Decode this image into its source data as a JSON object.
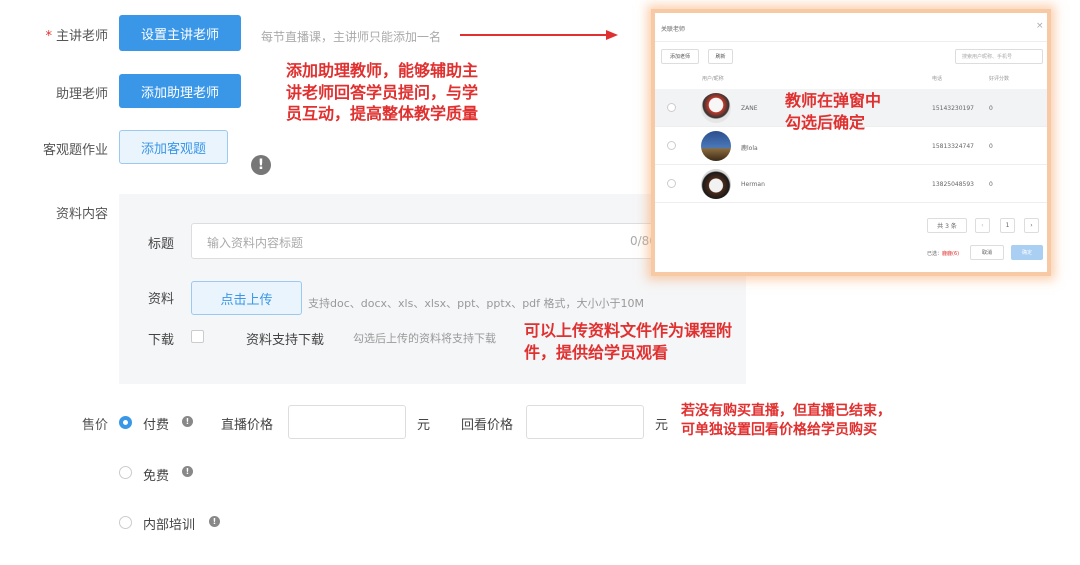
{
  "form": {
    "main_teacher": {
      "label": "主讲老师",
      "required_mark": "*",
      "button": "设置主讲老师",
      "hint": "每节直播课，主讲师只能添加一名"
    },
    "assistant": {
      "label": "助理老师",
      "button": "添加助理老师"
    },
    "objective": {
      "label": "客观题作业",
      "button": "添加客观题"
    },
    "material": {
      "label": "资料内容",
      "title_label": "标题",
      "title_placeholder": "输入资料内容标题",
      "title_counter": "0/80",
      "file_label": "资料",
      "upload_button": "点击上传",
      "upload_hint": "支持doc、docx、xls、xlsx、ppt、pptx、pdf 格式，大小小于10M",
      "download_label": "下载",
      "download_option": "资料支持下载",
      "download_hint": "勾选后上传的资料将支持下载"
    },
    "price": {
      "label": "售价",
      "options": [
        {
          "label": "付费",
          "selected": true
        },
        {
          "label": "免费",
          "selected": false
        },
        {
          "label": "内部培训",
          "selected": false
        }
      ],
      "live_price_label": "直播价格",
      "replay_price_label": "回看价格",
      "unit": "元"
    }
  },
  "annotations": {
    "assistant_line1": "添加助理教师，能够辅助主",
    "assistant_line2": "讲老师回答学员提问，与学",
    "assistant_line3": "员互动，提高整体教学质量",
    "modal_line1": "教师在弹窗中",
    "modal_line2": "勾选后确定",
    "material_line1": "可以上传资料文件作为课程附",
    "material_line2": "件，提供给学员观看",
    "price_line1": "若没有购买直播，但直播已结束，",
    "price_line2": "可单独设置回看价格给学员购买"
  },
  "modal": {
    "title": "关联老师",
    "close": "×",
    "add_button": "添加老师",
    "refresh_button": "刷新",
    "search_placeholder": "搜索用户昵称、手机号",
    "columns": {
      "user": "用户/昵称",
      "phone": "电话",
      "score": "好评分数"
    },
    "rows": [
      {
        "name": "ZANE",
        "phone": "15143230197",
        "score": "0"
      },
      {
        "name": "鹿lola",
        "phone": "15813324747",
        "score": "0"
      },
      {
        "name": "Herman",
        "phone": "13825048593",
        "score": "0"
      }
    ],
    "total": "共 3 条",
    "page": "1",
    "selected_prefix": "已选：",
    "selected_value": "鹿鹿(6)",
    "cancel": "取消",
    "confirm": "确定"
  },
  "colors": {
    "primary": "#3a97e8",
    "annotation": "#e0302f",
    "modal_glow": "#f7aa6e"
  }
}
